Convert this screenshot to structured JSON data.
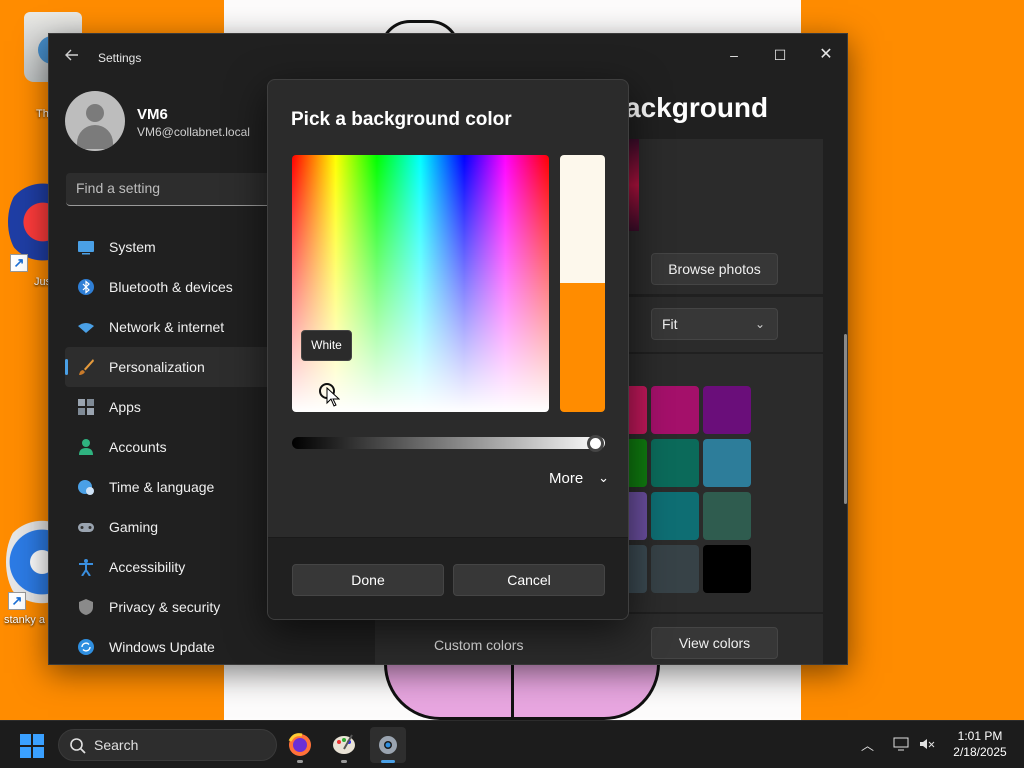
{
  "desktop": {
    "icons": [
      {
        "label": "Th"
      },
      {
        "label": "Jus"
      },
      {
        "label": "stanky a"
      }
    ]
  },
  "window": {
    "title": "Settings",
    "controls": {
      "minimize": "–",
      "maximize": "☐",
      "close": "✕"
    }
  },
  "profile": {
    "name": "VM6",
    "email": "VM6@collabnet.local"
  },
  "search": {
    "placeholder": "Find a setting"
  },
  "nav": {
    "items": [
      {
        "label": "System",
        "icon": "system-icon",
        "color": "#4aa0e6"
      },
      {
        "label": "Bluetooth & devices",
        "icon": "bluetooth-icon",
        "color": "#2f7fd6"
      },
      {
        "label": "Network & internet",
        "icon": "wifi-icon",
        "color": "#4aa0e6"
      },
      {
        "label": "Personalization",
        "icon": "paintbrush-icon",
        "color": "#e59a3c",
        "active": true
      },
      {
        "label": "Apps",
        "icon": "apps-icon",
        "color": "#9aa4b0"
      },
      {
        "label": "Accounts",
        "icon": "person-icon",
        "color": "#2fb380"
      },
      {
        "label": "Time & language",
        "icon": "globe-clock-icon",
        "color": "#4aa0e6"
      },
      {
        "label": "Gaming",
        "icon": "controller-icon",
        "color": "#9aa4b0"
      },
      {
        "label": "Accessibility",
        "icon": "accessibility-icon",
        "color": "#3a8fe0"
      },
      {
        "label": "Privacy & security",
        "icon": "shield-icon",
        "color": "#8a8a8a"
      },
      {
        "label": "Windows Update",
        "icon": "update-icon",
        "color": "#2f8fe0"
      }
    ]
  },
  "page": {
    "title_fragment": "ackground",
    "browse_label": "Browse photos",
    "fit_value": "Fit",
    "custom_colors_label": "Custom colors",
    "view_colors_label": "View colors",
    "swatches": [
      [
        "#c2185b",
        "#a4106a",
        "#6a0e7a"
      ],
      [
        "#107c10",
        "#0b6a5a",
        "#2d7d9a"
      ],
      [
        "#6b4fa0",
        "#0e6e73",
        "#2f5c4f"
      ],
      [
        "#3b4a52",
        "#374247",
        "#000000"
      ]
    ]
  },
  "dialog": {
    "title": "Pick a background color",
    "tooltip": "White",
    "old_color": "#fdf8ec",
    "new_color": "#ff8c00",
    "more_label": "More",
    "done_label": "Done",
    "cancel_label": "Cancel"
  },
  "taskbar": {
    "search_label": "Search",
    "apps": [
      "firefox-icon",
      "paint-icon",
      "settings-icon"
    ],
    "time": "1:01 PM",
    "date": "2/18/2025"
  }
}
